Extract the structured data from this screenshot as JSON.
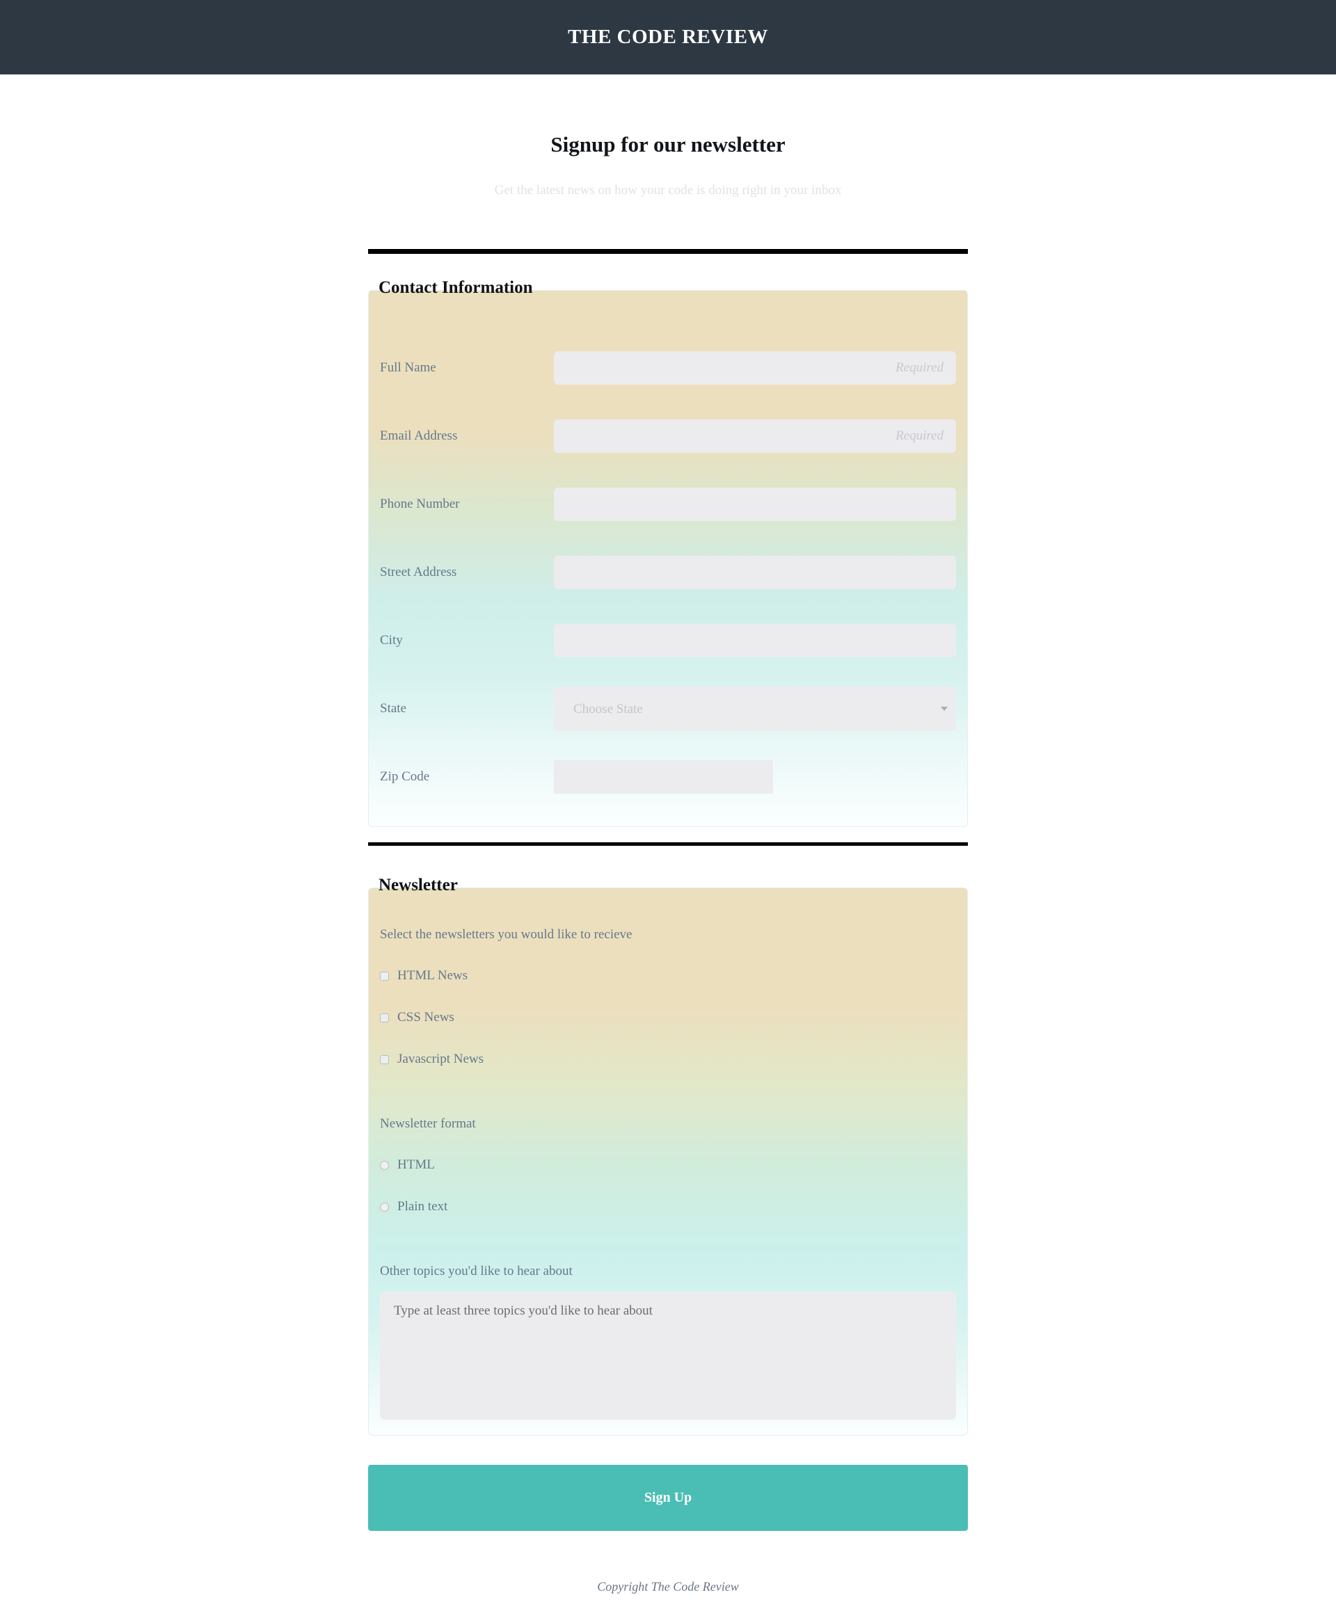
{
  "header": {
    "brand": "THE CODE REVIEW",
    "background_color": "#2d3842"
  },
  "intro": {
    "title": "Signup for our newsletter",
    "subtitle": "Get the latest news on how your code is doing right in your inbox"
  },
  "contact_section": {
    "legend": "Contact Information",
    "fields": [
      {
        "label": "Full Name",
        "placeholder": "Required",
        "value": "",
        "type": "text"
      },
      {
        "label": "Email Address",
        "placeholder": "Required",
        "value": "",
        "type": "email"
      },
      {
        "label": "Phone Number",
        "placeholder": "",
        "value": "",
        "type": "tel"
      },
      {
        "label": "Street Address",
        "placeholder": "",
        "value": "",
        "type": "text"
      },
      {
        "label": "City",
        "placeholder": "",
        "value": "",
        "type": "text"
      },
      {
        "label": "Zip Code",
        "placeholder": "",
        "value": "",
        "type": "text"
      }
    ],
    "state": {
      "label": "State",
      "selected": "Choose State",
      "options": [
        "Choose State"
      ]
    }
  },
  "newsletter_section": {
    "legend": "Newsletter",
    "checkbox_prompt": "Select the newsletters you would like to recieve",
    "checkboxes": [
      {
        "label": "HTML News",
        "checked": false
      },
      {
        "label": "CSS News",
        "checked": false
      },
      {
        "label": "Javascript News",
        "checked": false
      }
    ],
    "format_prompt": "Newsletter format",
    "radios": [
      {
        "label": "HTML",
        "checked": false
      },
      {
        "label": "Plain text",
        "checked": false
      }
    ],
    "topics_prompt": "Other topics you'd like to hear about",
    "topics_textarea": {
      "placeholder": "Type at least three topics you'd like to hear about",
      "value": ""
    }
  },
  "submit": {
    "label": "Sign Up",
    "color": "#4abdb5"
  },
  "footer": {
    "copyright": "Copyright The Code Review"
  }
}
